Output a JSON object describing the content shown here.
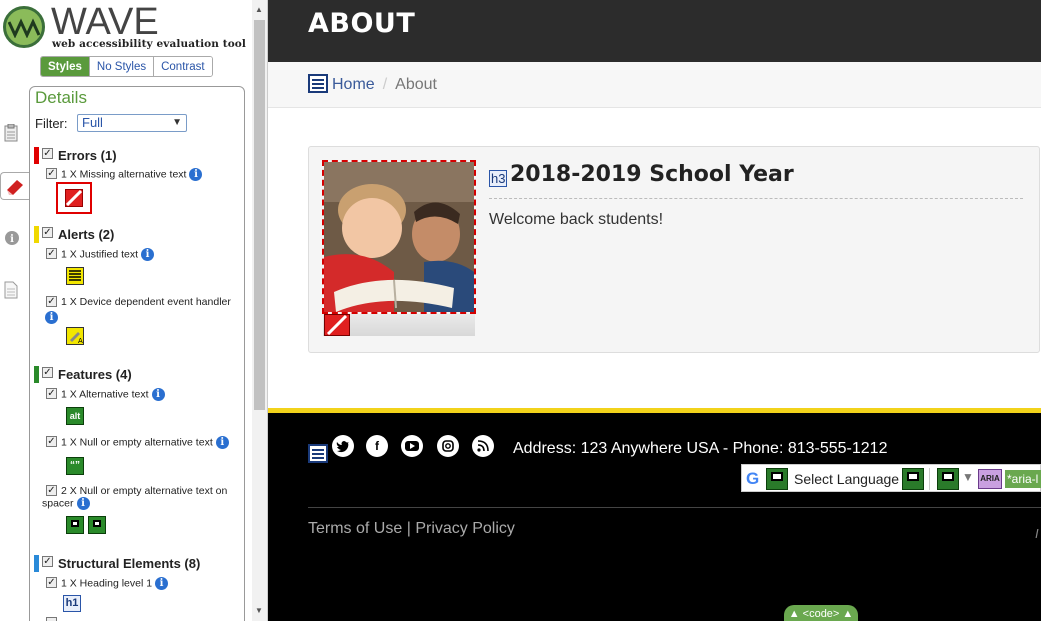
{
  "wave": {
    "logo_word": "WAVE",
    "logo_tagline": "web accessibility evaluation tool",
    "style_tabs": [
      "Styles",
      "No Styles",
      "Contrast"
    ],
    "panel_title": "Details",
    "filter_label": "Filter:",
    "filter_value": "Full",
    "categories": {
      "errors": {
        "label": "Errors (1)",
        "color": "#e00000"
      },
      "alerts": {
        "label": "Alerts (2)",
        "color": "#f0d800"
      },
      "features": {
        "label": "Features (4)",
        "color": "#2a8a2a"
      },
      "structural": {
        "label": "Structural Elements (8)",
        "color": "#2a8ad8"
      }
    },
    "items": {
      "missing_alt": "1 X Missing alternative text",
      "justified": "1 X Justified text",
      "device_handler": "1 X Device dependent event handler",
      "alt_text": "1 X Alternative text",
      "null_alt": "1 X Null or empty alternative text",
      "null_alt_spacer_1": "2 X Null or empty alternative text on",
      "null_alt_spacer_2": "spacer",
      "heading1": "1 X Heading level 1"
    },
    "icon_labels": {
      "alt": "alt",
      "h1": "h1",
      "quote": "“”",
      "info": "i"
    }
  },
  "page": {
    "hero_title": "ABOUT",
    "breadcrumb": {
      "home": "Home",
      "separator": "/",
      "current": "About"
    },
    "card": {
      "h3_tag": "h3",
      "title": "2018-2019 School Year",
      "text": "Welcome back students!"
    },
    "footer": {
      "address": "Address: 123 Anywhere USA - Phone: 813-555-1212",
      "translate_label": "Select Language",
      "aria_tag": "ARIA",
      "aria_label": "*aria-l",
      "terms": "Terms of Use",
      "divider": "|",
      "privacy": "Privacy Policy",
      "edge_char": "I"
    },
    "code_toggle": "▲ <code> ▲"
  }
}
